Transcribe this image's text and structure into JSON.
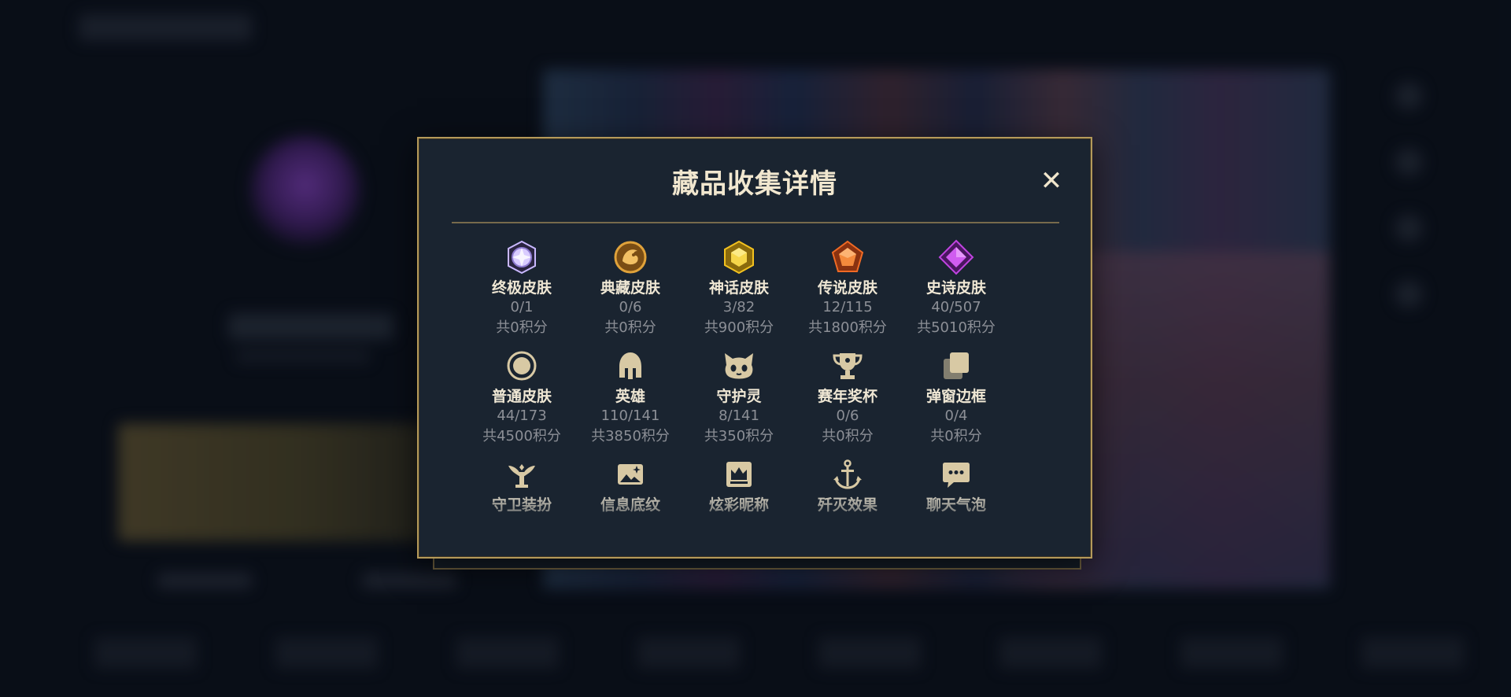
{
  "modal": {
    "title": "藏品收集详情",
    "close_icon": "close-icon"
  },
  "categories": [
    {
      "name": "终极皮肤",
      "count": "0/1",
      "points": "共0积分",
      "icon": "ultimate-skin-icon",
      "color": "#c9b8ff"
    },
    {
      "name": "典藏皮肤",
      "count": "0/6",
      "points": "共0积分",
      "icon": "dragon-emblem-icon",
      "color": "#e0a23a"
    },
    {
      "name": "神话皮肤",
      "count": "3/82",
      "points": "共900积分",
      "icon": "mythic-gem-icon",
      "color": "#f3c21f"
    },
    {
      "name": "传说皮肤",
      "count": "12/115",
      "points": "共1800积分",
      "icon": "legendary-gem-icon",
      "color": "#f06a24"
    },
    {
      "name": "史诗皮肤",
      "count": "40/507",
      "points": "共5010积分",
      "icon": "epic-gem-icon",
      "color": "#c044e0"
    },
    {
      "name": "普通皮肤",
      "count": "44/173",
      "points": "共4500积分",
      "icon": "ring-icon",
      "color": "#d8c9a4"
    },
    {
      "name": "英雄",
      "count": "110/141",
      "points": "共3850积分",
      "icon": "helmet-icon",
      "color": "#d8c9a4"
    },
    {
      "name": "守护灵",
      "count": "8/141",
      "points": "共350积分",
      "icon": "little-legend-icon",
      "color": "#d8c9a4"
    },
    {
      "name": "赛年奖杯",
      "count": "0/6",
      "points": "共0积分",
      "icon": "trophy-icon",
      "color": "#d8c9a4"
    },
    {
      "name": "弹窗边框",
      "count": "0/4",
      "points": "共0积分",
      "icon": "frames-icon",
      "color": "#d8c9a4"
    },
    {
      "name": "守卫装扮",
      "icon": "ward-icon",
      "color": "#d8c9a4"
    },
    {
      "name": "信息底纹",
      "icon": "banner-image-icon",
      "color": "#d8c9a4"
    },
    {
      "name": "炫彩昵称",
      "icon": "crown-nameplate-icon",
      "color": "#d8c9a4"
    },
    {
      "name": "歼灭效果",
      "icon": "anchor-icon",
      "color": "#d8c9a4"
    },
    {
      "name": "聊天气泡",
      "icon": "chat-bubble-icon",
      "color": "#d8c9a4"
    }
  ]
}
